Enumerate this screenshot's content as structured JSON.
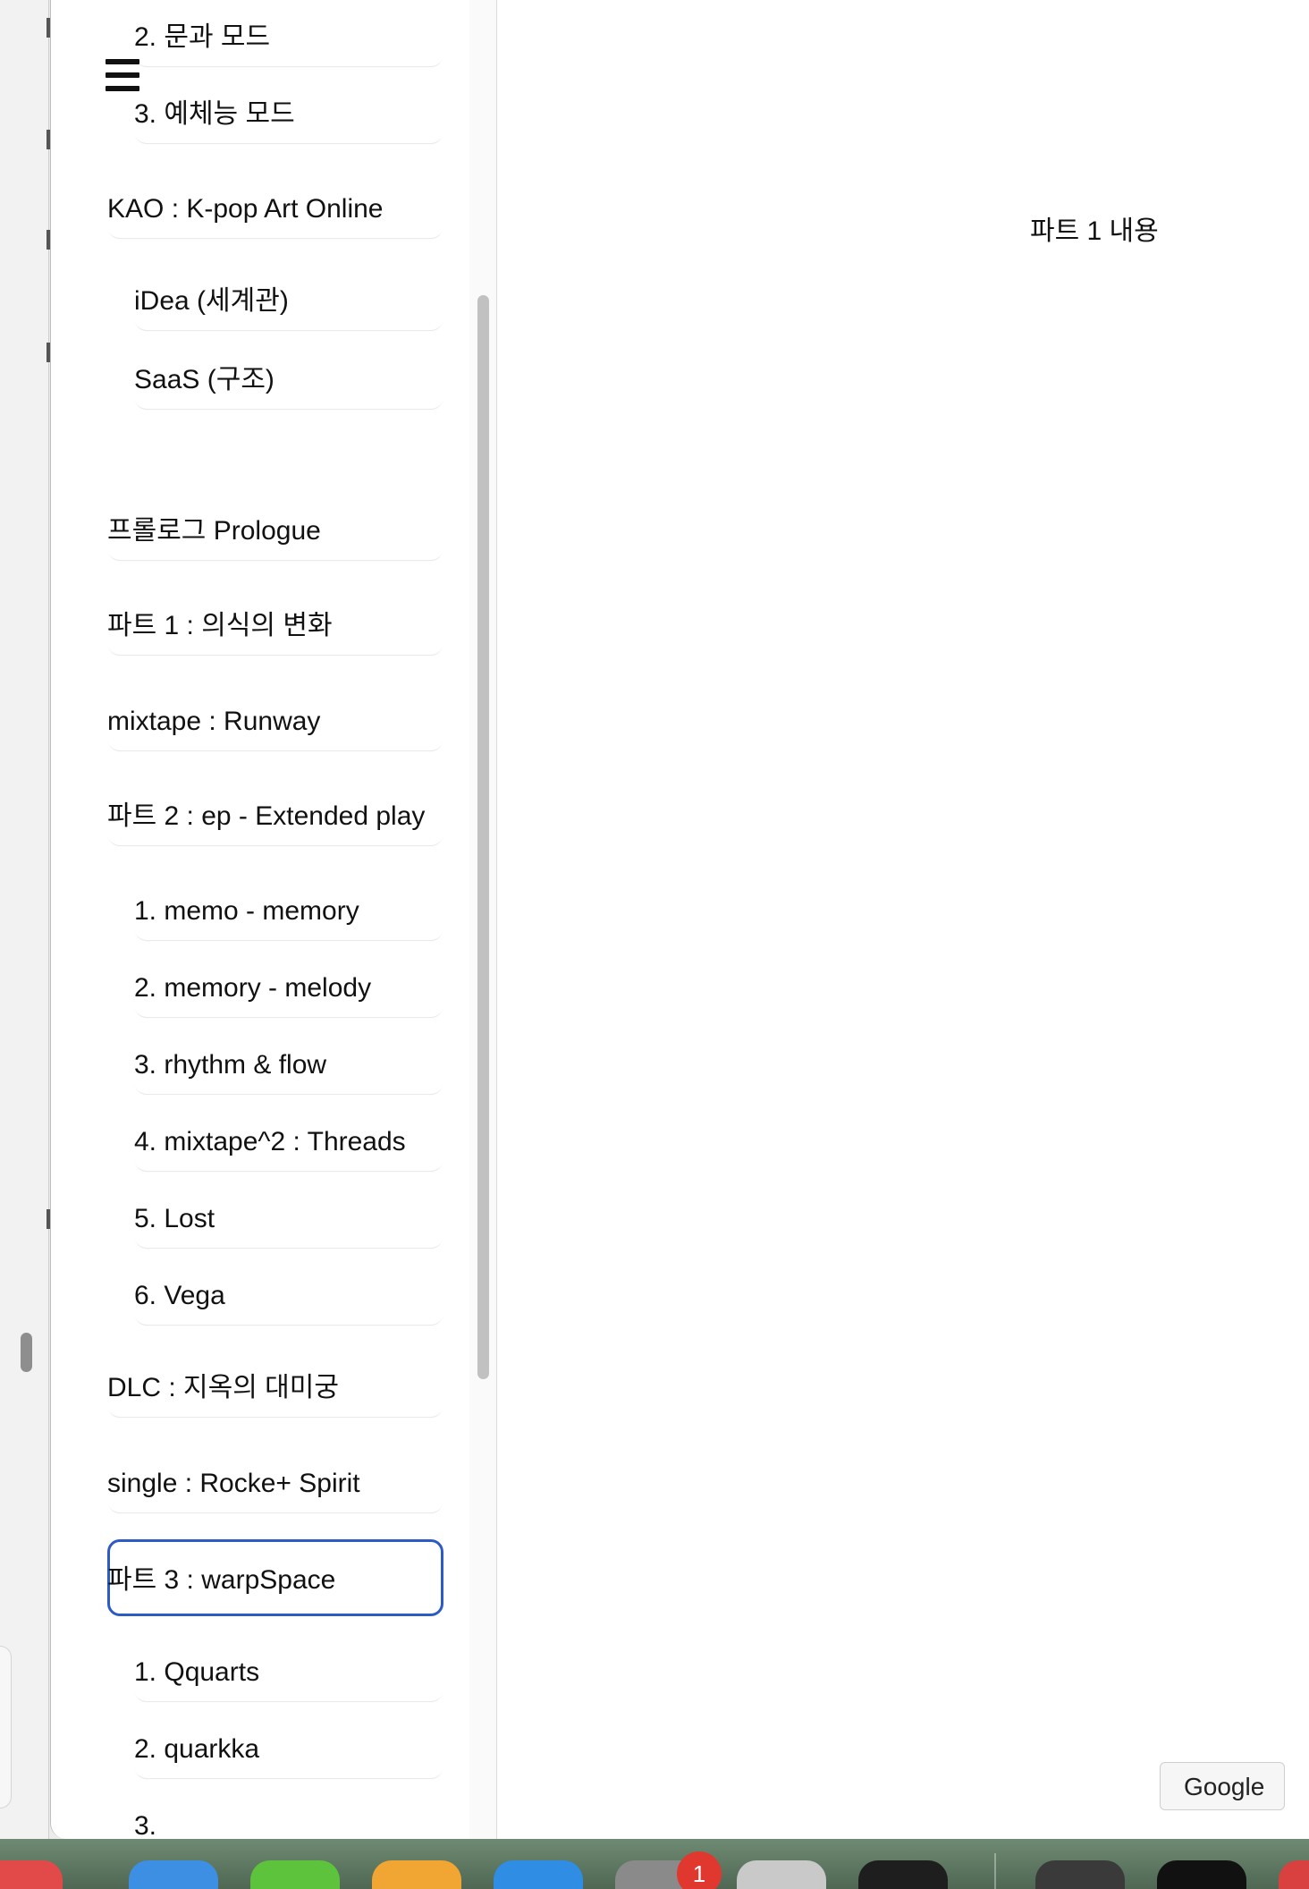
{
  "sidebar": {
    "menu_button_label": "menu",
    "items": [
      {
        "label": "2. 문과 모드",
        "level": 2
      },
      {
        "label": "3. 예체능 모드",
        "level": 2
      },
      {
        "label": "KAO : K-pop Art Online",
        "level": 1
      },
      {
        "label": "iDea (세계관)",
        "level": 2
      },
      {
        "label": "SaaS (구조)",
        "level": 2
      },
      {
        "label": "프롤로그 Prologue",
        "level": 1
      },
      {
        "label": "파트 1 : 의식의 변화",
        "level": 1
      },
      {
        "label": "mixtape : Runway",
        "level": 1
      },
      {
        "label": "파트 2 : ep - Extended play",
        "level": 1
      },
      {
        "label": "1. memo - memory",
        "level": 2
      },
      {
        "label": "2. memory - melody",
        "level": 2
      },
      {
        "label": "3. rhythm & flow",
        "level": 2
      },
      {
        "label": "4. mixtape^2 : Threads",
        "level": 2
      },
      {
        "label": "5. Lost",
        "level": 2
      },
      {
        "label": "6. Vega",
        "level": 2
      },
      {
        "label": "DLC : 지옥의 대미궁",
        "level": 1
      },
      {
        "label": "single : Rocke+ Spirit",
        "level": 1
      },
      {
        "label": "파트 3 : warpSpace",
        "level": 1,
        "selected": true
      },
      {
        "label": "1. Qquarts",
        "level": 2
      },
      {
        "label": "2. quarkka",
        "level": 2
      },
      {
        "label": "3.",
        "level": 2
      }
    ]
  },
  "content": {
    "text": "파트 1 내용"
  },
  "google_button": {
    "label": "Google"
  },
  "dock": {
    "notification_badge": "1"
  },
  "colors": {
    "selected_outline": "#2d5bc4",
    "badge": "#e0382f"
  }
}
